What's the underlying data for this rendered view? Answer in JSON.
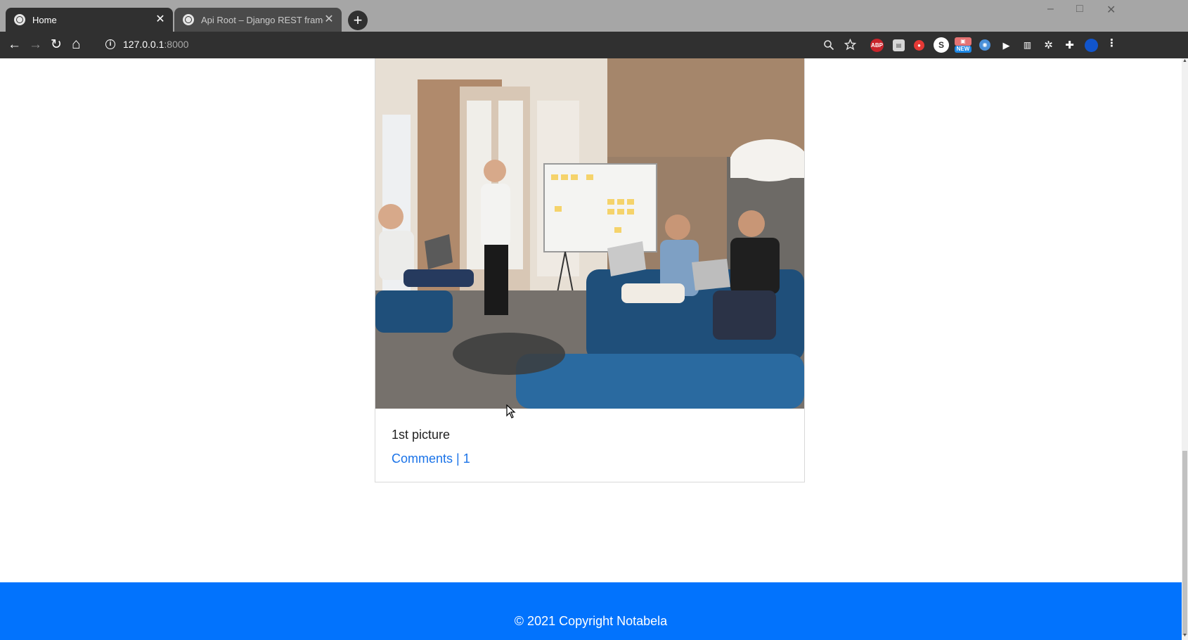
{
  "browser": {
    "tabs": [
      {
        "title": "Home",
        "active": true
      },
      {
        "title": "Api Root – Django REST framewo",
        "active": false
      }
    ],
    "new_tab_label": "+",
    "window_controls": {
      "minimize": "–",
      "maximize": "□",
      "close": "✕"
    },
    "nav": {
      "back": "←",
      "forward": "→",
      "reload": "↻",
      "home": "⌂"
    },
    "address": {
      "host": "127.0.0.1",
      "port": ":8000"
    },
    "toolbar_icons": [
      "zoom-icon",
      "bookmark-star-icon",
      "adblock-plus-icon",
      "extension-icon",
      "extension-icon",
      "extension-icon",
      "extension-icon",
      "extension-icon",
      "extension-icon",
      "extension-icon",
      "extension-icon",
      "extensions-puzzle-icon",
      "profile-icon",
      "menu-dots-icon"
    ],
    "extensions": {
      "abp": "ABP",
      "new_badge": "NEW",
      "s_badge": "S"
    }
  },
  "post": {
    "title": "1st picture",
    "comments_link": "Comments | 1"
  },
  "footer": {
    "text": "© 2021 Copyright Notabela",
    "color": "#0273fd"
  },
  "colors": {
    "link": "#1a73e8",
    "chrome_dark": "#303030"
  }
}
